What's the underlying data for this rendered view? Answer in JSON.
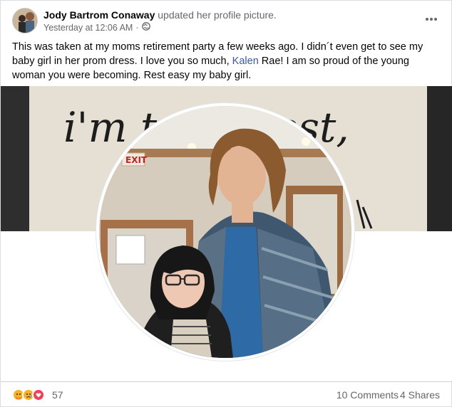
{
  "post": {
    "author_name": "Jody Bartrom Conaway",
    "action_text": "updated her profile picture.",
    "timestamp": "Yesterday at 12:06 AM",
    "audience_separator": "·",
    "audience_icon": "globe-icon",
    "more_icon": "more-options-icon",
    "caption_part1": "This was taken at my moms retirement party a few weeks ago. I didn´t even get to see my baby girl in her prom dress. I love you so much, ",
    "caption_mention": "Kalen",
    "caption_part2": " Rae! I am so proud of the young woman you were becoming. Rest easy my baby girl.",
    "cover_text": "i'm try... best,",
    "exit_sign": "EXIT"
  },
  "footer": {
    "reaction_icons": [
      "care-reaction-icon",
      "sad-reaction-icon",
      "love-reaction-icon"
    ],
    "reaction_count": "57",
    "comments": "10 Comments",
    "shares": "4 Shares"
  },
  "colors": {
    "link": "#385898",
    "secondary_text": "#65676b",
    "love": "#f33e58",
    "care_sad": "#f7b125"
  }
}
